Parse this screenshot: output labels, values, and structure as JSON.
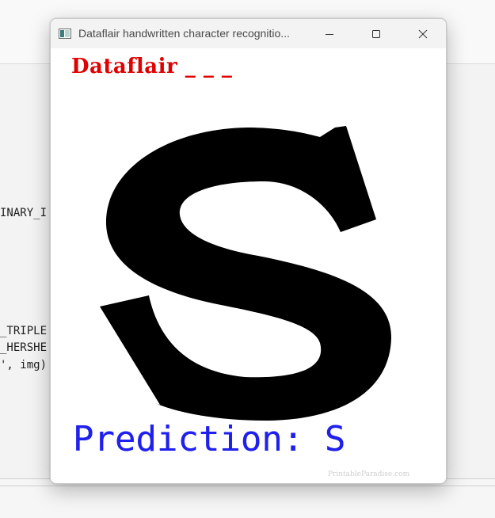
{
  "background_editor": {
    "code_fragments": [
      {
        "text": "INARY_I"
      },
      {
        "text": "_TRIPLE"
      },
      {
        "text": "_HERSHE"
      },
      {
        "text": "', img)"
      }
    ]
  },
  "window": {
    "title": "Dataflair handwritten character recognitio...",
    "controls": {
      "minimize": "minimize",
      "maximize": "maximize",
      "close": "close"
    }
  },
  "canvas": {
    "brand_text": "Dataflair _ _ _",
    "sample_letter": "S",
    "prediction_text": "Prediction: S",
    "watermark": "PrintableParadise.com"
  },
  "colors": {
    "brand": "#e00000",
    "prediction": "#2020ee",
    "glyph": "#000000"
  },
  "icons": [
    "app-icon",
    "minimize-icon",
    "maximize-icon",
    "close-icon"
  ]
}
